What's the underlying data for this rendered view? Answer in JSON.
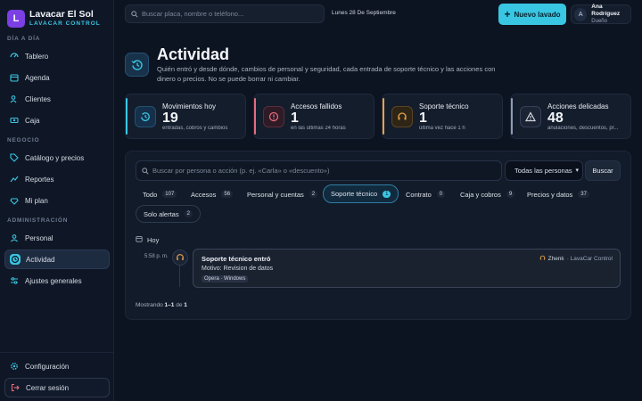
{
  "brand": {
    "initial": "L",
    "title": "Lavacar El Sol",
    "subtitle": "LAVACAR CONTROL"
  },
  "sidebar": {
    "sections": [
      "DÍA A DÍA",
      "NEGOCIO",
      "ADMINISTRACIÓN"
    ],
    "items": [
      {
        "label": "Tablero",
        "icon": "dashboard-icon"
      },
      {
        "label": "Agenda",
        "icon": "calendar-icon"
      },
      {
        "label": "Clientes",
        "icon": "users-icon"
      },
      {
        "label": "Caja",
        "icon": "cash-icon"
      },
      {
        "label": "Catálogo y precios",
        "icon": "tag-icon"
      },
      {
        "label": "Reportes",
        "icon": "chart-icon"
      },
      {
        "label": "Mi plan",
        "icon": "gem-icon"
      },
      {
        "label": "Personal",
        "icon": "staff-icon"
      },
      {
        "label": "Actividad",
        "icon": "history-icon",
        "active": true
      },
      {
        "label": "Ajustes generales",
        "icon": "sliders-icon"
      }
    ],
    "config": "Configuración",
    "logout": "Cerrar sesión"
  },
  "topbar": {
    "search_placeholder": "Buscar placa, nombre o teléfono...",
    "date": "Lunes 28 De Septiembre",
    "new_button": "Nuevo lavado",
    "user": {
      "initial": "A",
      "name": "Ana Rodríguez",
      "role": "Dueño"
    }
  },
  "header": {
    "title": "Actividad",
    "description": "Quién entró y desde dónde, cambios de personal y seguridad, cada entrada de soporte técnico y las acciones con dinero o precios. No se puede borrar ni cambiar."
  },
  "cards": [
    {
      "title": "Movimientos hoy",
      "value": "19",
      "sub": "entradas, cobros y cambios",
      "color": "#39c6e3"
    },
    {
      "title": "Accesos fallidos",
      "value": "1",
      "sub": "en las últimas 24 horas",
      "color": "#e56b7d"
    },
    {
      "title": "Soporte técnico",
      "value": "1",
      "sub": "última vez hace 1 h",
      "color": "#e8a24a"
    },
    {
      "title": "Acciones delicadas",
      "value": "48",
      "sub": "anulaciones, descuentos, pr...",
      "color": "#8e9bb3"
    }
  ],
  "filters": {
    "search_placeholder": "Buscar por persona o acción (p. ej. «Carla» o «descuento»)",
    "select_value": "Todas las personas",
    "search_button": "Buscar"
  },
  "chips": [
    {
      "label": "Todo",
      "count": "107"
    },
    {
      "label": "Accesos",
      "count": "56"
    },
    {
      "label": "Personal y cuentas",
      "count": "2"
    },
    {
      "label": "Soporte técnico",
      "count": "1",
      "active": true
    },
    {
      "label": "Contrato",
      "count": "0"
    },
    {
      "label": "Caja y cobros",
      "count": "9"
    },
    {
      "label": "Precios y datos",
      "count": "37"
    },
    {
      "label": "Solo alertas",
      "count": "2"
    }
  ],
  "timeline": {
    "day": "Hoy",
    "time": "5:58 p. m.",
    "event": {
      "title": "Soporte técnico entró",
      "actor": "Zhenk",
      "actor_org": "· LavaCar Control",
      "reason": "Motivo: Revision de datos",
      "tag": "Opera · Windows"
    }
  },
  "footer": {
    "prefix": "Mostrando",
    "range": "1–1",
    "of": "de",
    "total": "1"
  }
}
